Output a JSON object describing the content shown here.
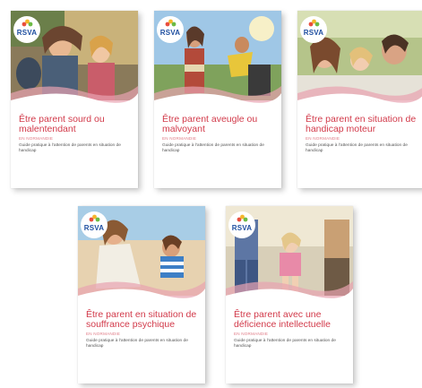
{
  "logo_text": "RSVA",
  "colors": {
    "accent": "#d23a4a",
    "logo_blue": "#1f4fa0"
  },
  "guides": [
    {
      "title": "Être parent sourd ou malentendant",
      "region": "EN NORMANDIE",
      "subtitle": "Guide pratique à l’attention de parents en situation de handicap"
    },
    {
      "title": "Être parent aveugle ou malvoyant",
      "region": "EN NORMANDIE",
      "subtitle": "Guide pratique à l’attention de parents en situation de handicap"
    },
    {
      "title": "Être parent en situation de handicap moteur",
      "region": "EN NORMANDIE",
      "subtitle": "Guide pratique à l’attention de parents en situation de handicap"
    },
    {
      "title": "Être parent en situation de souffrance psychique",
      "region": "EN NORMANDIE",
      "subtitle": "Guide pratique à l’attention de parents en situation de handicap"
    },
    {
      "title": "Être parent avec une déficience intellectuelle",
      "region": "EN NORMANDIE",
      "subtitle": "Guide pratique à l’attention de parents en situation de handicap"
    }
  ]
}
